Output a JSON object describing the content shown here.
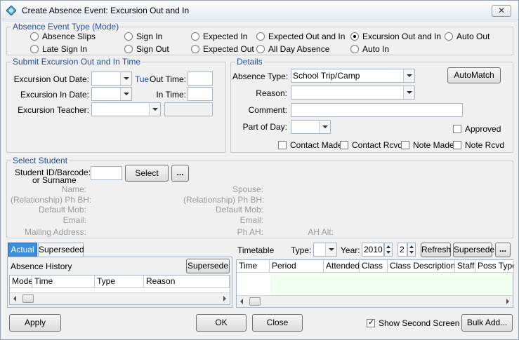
{
  "window": {
    "title": "Create Absence Event: Excursion Out and In",
    "close_glyph": "✕"
  },
  "event_type": {
    "legend": "Absence Event Type (Mode)",
    "options": [
      {
        "label": "Absence Slips",
        "selected": false
      },
      {
        "label": "Sign In",
        "selected": false
      },
      {
        "label": "Expected In",
        "selected": false
      },
      {
        "label": "Expected Out and In",
        "selected": false
      },
      {
        "label": "Excursion Out and In",
        "selected": true
      },
      {
        "label": "Auto Out",
        "selected": false
      },
      {
        "label": "Late Sign In",
        "selected": false
      },
      {
        "label": "Sign Out",
        "selected": false
      },
      {
        "label": "Expected Out",
        "selected": false
      },
      {
        "label": "All Day Absence",
        "selected": false
      },
      {
        "label": "Auto In",
        "selected": false
      }
    ]
  },
  "submit": {
    "legend": "Submit Excursion Out and In Time",
    "out_date_label": "Excursion Out Date:",
    "out_date_value": "",
    "day_label": "Tue",
    "out_time_label": "Out Time:",
    "out_time_value": "",
    "in_date_label": "Excursion In Date:",
    "in_date_value": "",
    "in_time_label": "In Time:",
    "in_time_value": "",
    "teacher_label": "Excursion Teacher:",
    "teacher_value": "",
    "teacher_code": ""
  },
  "details": {
    "legend": "Details",
    "absence_type_label": "Absence Type:",
    "absence_type_value": "School Trip/Camp",
    "automatch_label": "AutoMatch",
    "reason_label": "Reason:",
    "reason_value": "",
    "comment_label": "Comment:",
    "comment_value": "",
    "part_of_day_label": "Part of Day:",
    "part_of_day_value": "",
    "approved_label": "Approved",
    "approved_checked": false,
    "contact_made_label": "Contact Made",
    "contact_rcvd_label": "Contact Rcvd",
    "note_made_label": "Note Made",
    "note_rcvd_label": "Note Rcvd"
  },
  "student": {
    "legend": "Select Student",
    "id_label_line1": "Student ID/Barcode:",
    "id_label_line2": "or Surname",
    "id_value": "",
    "select_label": "Select",
    "more_label": "...",
    "name_label": "Name:",
    "ph_bh_label_left": "(Relationship) Ph BH:",
    "default_mob_label_left": "Default Mob:",
    "email_label_left": "Email:",
    "mailing_label": "Mailing Address:",
    "spouse_label": "Spouse:",
    "ph_bh_label_right": "(Relationship) Ph BH:",
    "default_mob_label_right": "Default Mob:",
    "email_label_right": "Email:",
    "ph_ah_label": "Ph AH:",
    "ah_alt_label": "AH Alt:"
  },
  "history": {
    "tab_actual": "Actual",
    "tab_superseded": "Superseded",
    "title": "Absence History",
    "supersede_label": "Supersede",
    "columns": [
      "Mode",
      "Time",
      "Type",
      "Reason"
    ]
  },
  "timetable": {
    "label": "Timetable",
    "type_label": "Type:",
    "type_value": "",
    "year_label": "Year:",
    "year_value": "2010",
    "term_value": "2",
    "refresh_label": "Refresh",
    "supersede_label": "Supersede",
    "more_label": "...",
    "columns": [
      "Time",
      "Period",
      "Attended",
      "Class",
      "Class Description",
      "Staff",
      "Poss Type"
    ]
  },
  "footer": {
    "apply_label": "Apply",
    "ok_label": "OK",
    "close_label": "Close",
    "second_screen_label": "Show Second Screen",
    "second_screen_checked": true,
    "bulk_add_label": "Bulk Add..."
  },
  "colors": {
    "legend": "#1f4f9a",
    "active_tab": "#3c8ddb",
    "grid_stripe": "#f0fff0"
  }
}
